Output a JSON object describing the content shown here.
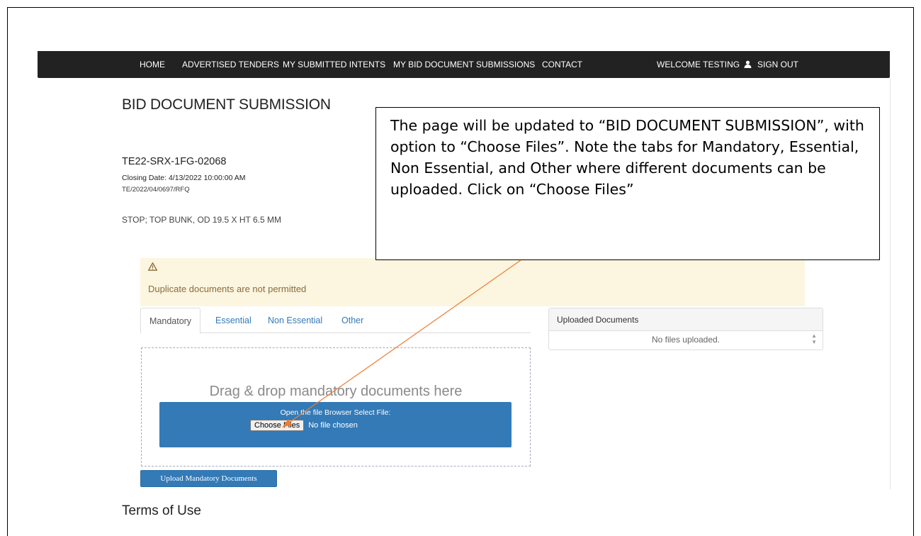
{
  "nav": {
    "home": "HOME",
    "advertised_tenders": "ADVERTISED TENDERS",
    "my_submitted_intents": "MY SUBMITTED INTENTS",
    "my_bid_document_submissions": "MY BID DOCUMENT SUBMISSIONS",
    "contact": "CONTACT",
    "welcome": "WELCOME TESTING",
    "user_icon": "user-icon",
    "sign_out": "SIGN OUT"
  },
  "page": {
    "title": "BID DOCUMENT SUBMISSION"
  },
  "tender": {
    "number": "TE22-SRX-1FG-02068",
    "closing_date": "Closing Date: 4/13/2022 10:00:00 AM",
    "reference": "TE/2022/04/0697/RFQ",
    "description": "STOP; TOP BUNK, OD 19.5 X HT 6.5 MM"
  },
  "alert": {
    "icon": "warning-icon",
    "message": "Duplicate documents are not permitted"
  },
  "tabs": [
    "Mandatory",
    "Essential",
    "Non Essential",
    "Other"
  ],
  "active_tab": "Mandatory",
  "dropzone": {
    "title": "Drag & drop mandatory documents here",
    "browse_label": "Open the file Browser Select File:",
    "choose_button": "Choose Files",
    "no_file": "No file chosen"
  },
  "upload_button": "Upload Mandatory Documents",
  "terms_heading": "Terms of Use",
  "uploaded": {
    "header": "Uploaded Documents",
    "empty": "No files uploaded."
  },
  "callout": {
    "text": "The page will be updated to “BID DOCUMENT SUBMISSION”, with option to “Choose Files”. Note the tabs for Mandatory, Essential, Non Essential, and Other where different documents can be uploaded. Click on “Choose Files”"
  },
  "colors": {
    "navbar": "#222222",
    "primary": "#337ab7",
    "alert_bg": "#fcf5e0",
    "alert_text": "#8a6d3b",
    "arrow": "#ed7d31"
  }
}
